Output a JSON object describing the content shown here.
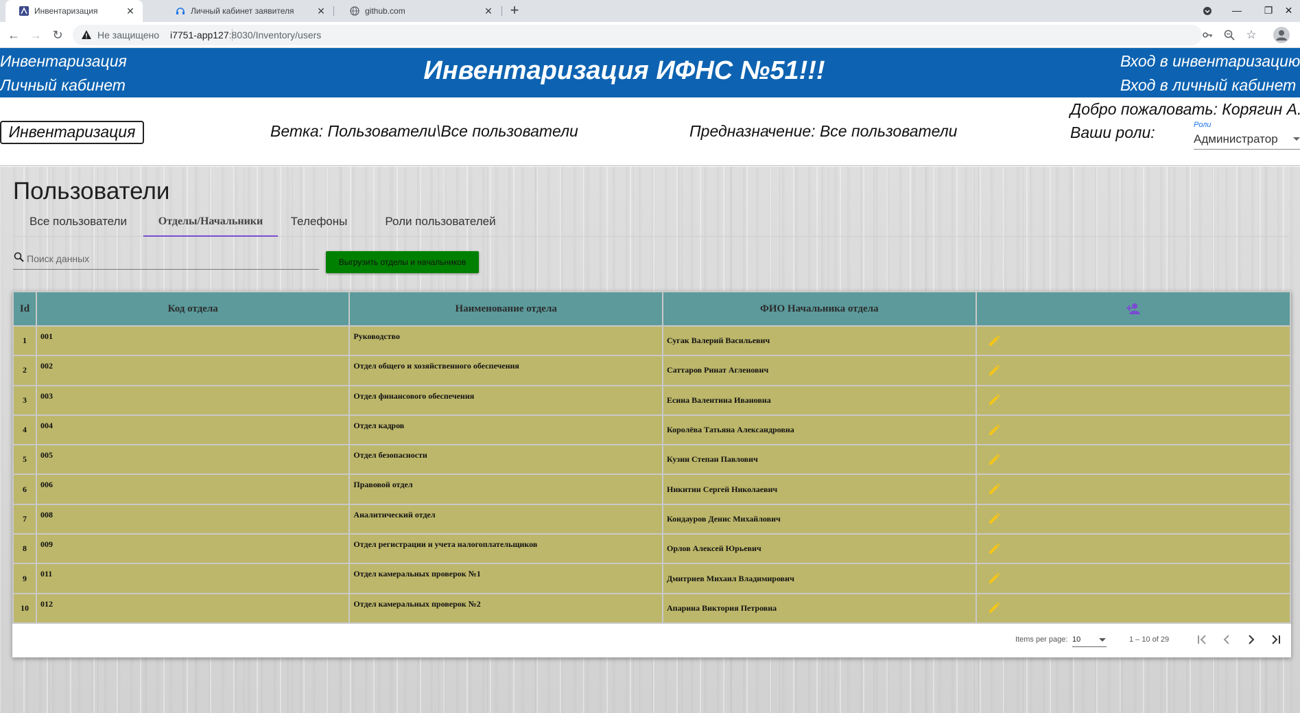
{
  "browser": {
    "tabs": [
      {
        "title": "Инвентаризация",
        "active": true
      },
      {
        "title": "Личный кабинет заявителя",
        "active": false
      },
      {
        "title": "github.com",
        "active": false
      }
    ],
    "insecure_label": "Не защищено",
    "url_host": "i7751-app127",
    "url_path": ":8030/Inventory/users"
  },
  "header": {
    "left_link_1": "Инвентаризация",
    "left_link_2": "Личный кабинет",
    "title": "Инвентаризация ИФНС №51!!!",
    "right_link_1": "Вход в инвентаризацию",
    "right_link_2": "Вход в личный кабинет"
  },
  "subheader": {
    "inventory_button": "Инвентаризация",
    "branch": "Ветка: Пользователи\\Все пользователи",
    "purpose": "Предназначение: Все пользователи",
    "welcome": "Добро пожаловать: Корягин А.С.",
    "roles_label": "Ваши роли:",
    "roles_field_label": "Роли",
    "roles_value": "Администратор"
  },
  "page": {
    "title": "Пользователи",
    "tabs": [
      "Все пользователи",
      "Отделы/Начальники",
      "Телефоны",
      "Роли пользователей"
    ],
    "active_tab": 1,
    "search_placeholder": "Поиск данных",
    "export_button": "Выгрузить отделы и начальников"
  },
  "table": {
    "headers": [
      "Id",
      "Код отдела",
      "Наименование отдела",
      "ФИО Начальника отдела"
    ],
    "rows": [
      {
        "id": "1",
        "code": "001",
        "name": "Руководство",
        "head": "Сугак Валерий Васильевич"
      },
      {
        "id": "2",
        "code": "002",
        "name": "Отдел общего и хозяйственного обеспечения",
        "head": "Саттаров Ринат Агленович"
      },
      {
        "id": "3",
        "code": "003",
        "name": "Отдел финансового обеспечения",
        "head": "Есина Валентина Ивановна"
      },
      {
        "id": "4",
        "code": "004",
        "name": "Отдел кадров",
        "head": "Королёва Татьяна Александровна"
      },
      {
        "id": "5",
        "code": "005",
        "name": "Отдел безопасности",
        "head": "Кузин Степан Павлович"
      },
      {
        "id": "6",
        "code": "006",
        "name": "Правовой отдел",
        "head": "Никитин Сергей Николаевич"
      },
      {
        "id": "7",
        "code": "008",
        "name": "Аналитический отдел",
        "head": "Кондауров Денис Михайлович"
      },
      {
        "id": "8",
        "code": "009",
        "name": "Отдел регистрации и учета налогоплательщиков",
        "head": "Орлов Алексей Юрьевич"
      },
      {
        "id": "9",
        "code": "011",
        "name": "Отдел камеральных проверок №1",
        "head": "Дмитриев Михаил Владимирович"
      },
      {
        "id": "10",
        "code": "012",
        "name": "Отдел камеральных проверок №2",
        "head": "Апарина Виктория Петровна"
      }
    ]
  },
  "paginator": {
    "items_per_page_label": "Items per page:",
    "items_per_page": "10",
    "range": "1 – 10 of 29"
  },
  "colors": {
    "header_blue": "#0d63b1",
    "table_header": "#5c9a9b",
    "table_row": "#bdb76b",
    "export_green": "#008000",
    "tab_underline": "#7b4bd1",
    "edit_icon": "#f5c518",
    "add_user_icon": "#7b4bd1"
  }
}
